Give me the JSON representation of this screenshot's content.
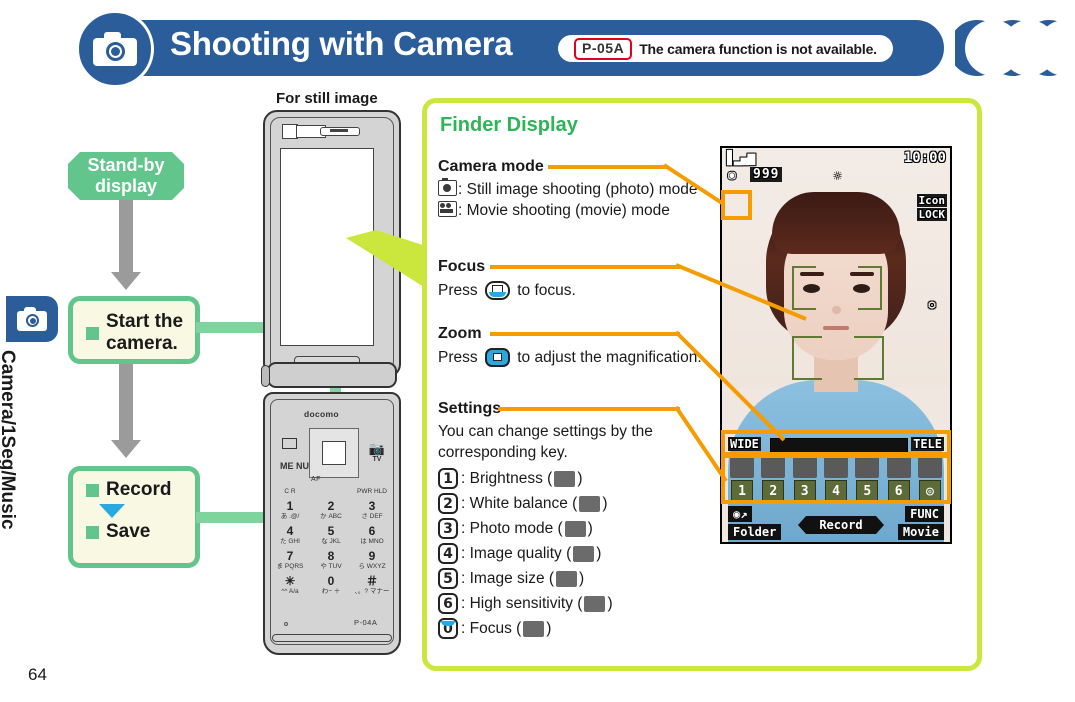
{
  "header": {
    "title": "Shooting with Camera",
    "model_badge": "P-05A",
    "note": "The camera function is not available.",
    "icon": "camera-icon",
    "bar_color": "#2c5d9b",
    "badge_border_color": "#e3001b"
  },
  "sidebar": {
    "chapter_label": "Camera/1Seg/Music",
    "icon": "camera-icon",
    "page_number": "64"
  },
  "flow": {
    "standby_label": "Stand-by display",
    "steps": [
      {
        "label": "Start the camera."
      },
      {
        "label_top": "Record",
        "label_bottom": "Save",
        "arrow": "down-triangle"
      }
    ],
    "accent_color": "#62c58c",
    "box_fill": "#f8f8e3"
  },
  "phone": {
    "caption": "For still image",
    "brand": "docomo",
    "menu_key": "ME NU",
    "camera_key_label": "TV",
    "af_label": "AF",
    "model_code": "P-04A",
    "keys": [
      [
        {
          "main": "1",
          "sub": "あ .@/"
        },
        {
          "main": "2",
          "sub": "か ABC"
        },
        {
          "main": "3",
          "sub": "さ DEF"
        }
      ],
      [
        {
          "main": "4",
          "sub": "た GHI"
        },
        {
          "main": "5",
          "sub": "な JKL"
        },
        {
          "main": "6",
          "sub": "は MNO"
        }
      ],
      [
        {
          "main": "7",
          "sub": "ま PQRS"
        },
        {
          "main": "8",
          "sub": "や TUV"
        },
        {
          "main": "9",
          "sub": "ら WXYZ"
        }
      ],
      [
        {
          "main": "✳",
          "sub": "^^ A/a"
        },
        {
          "main": "0",
          "sub": "わ− ＋"
        },
        {
          "main": "＃",
          "sub": "、。? マナー"
        }
      ]
    ],
    "call_key": "C R",
    "end_key": "PWR HLD"
  },
  "finder": {
    "title": "Finder Display",
    "sections": [
      {
        "heading": "Camera mode",
        "lines": [
          ": Still image shooting (photo) mode",
          ": Movie shooting (movie) mode"
        ],
        "icons": [
          "still-photo-icon",
          "movie-camera-icon"
        ]
      },
      {
        "heading": "Focus",
        "text_before": "Press",
        "text_after": "to focus.",
        "key_icon": "center-select-key-icon"
      },
      {
        "heading": "Zoom",
        "text_before": "Press",
        "text_after": "to adjust the magnification.",
        "key_icon": "four-way-key-icon"
      },
      {
        "heading": "Settings",
        "text": "You can change settings by the corresponding key.",
        "items": [
          {
            "key": "1",
            "label": ": Brightness (",
            "close": ")",
            "icon": "brightness-icon"
          },
          {
            "key": "2",
            "label": ": White balance (",
            "close": ")",
            "icon": "white-balance-auto-icon"
          },
          {
            "key": "3",
            "label": ": Photo mode (",
            "close": ")",
            "icon": "photo-mode-normal-icon"
          },
          {
            "key": "4",
            "label": ": Image quality (",
            "close": ")",
            "icon": "image-quality-fine-icon"
          },
          {
            "key": "5",
            "label": ": Image size (",
            "close": ")",
            "icon": "image-size-icon"
          },
          {
            "key": "6",
            "label": ": High sensitivity (",
            "close": ")",
            "icon": "high-sensitivity-icon"
          },
          {
            "key": "0",
            "label": ": Focus (",
            "close": ")",
            "icon": "focus-icon"
          }
        ]
      }
    ],
    "title_color": "#2fb457",
    "border_color": "#cbe63c",
    "callout_color": "#f59c00"
  },
  "screen": {
    "status_left": "signal-battery-icons",
    "clock": "10:00",
    "shots_remaining": "999",
    "mode_icon": "still-photo-icon",
    "lock_text_line1": "Icon",
    "lock_text_line2": "LOCK",
    "zoom_wide_label": "WIDE",
    "zoom_tele_label": "TELE",
    "setting_numbers": [
      "1",
      "2",
      "3",
      "4",
      "5",
      "6",
      "◎"
    ],
    "setting_icons": [
      "brightness-icon",
      "white-balance-auto-icon",
      "photo-mode-normal-icon",
      "image-quality-fine-icon",
      "image-size-icon",
      "high-sensitivity-icon",
      "focus-icon"
    ],
    "softkey_left_top": "camera-folder-icon",
    "softkey_left_bottom": "Folder",
    "softkey_center": "Record",
    "softkey_right_top": "FUNC",
    "softkey_right_bottom": "Movie"
  }
}
